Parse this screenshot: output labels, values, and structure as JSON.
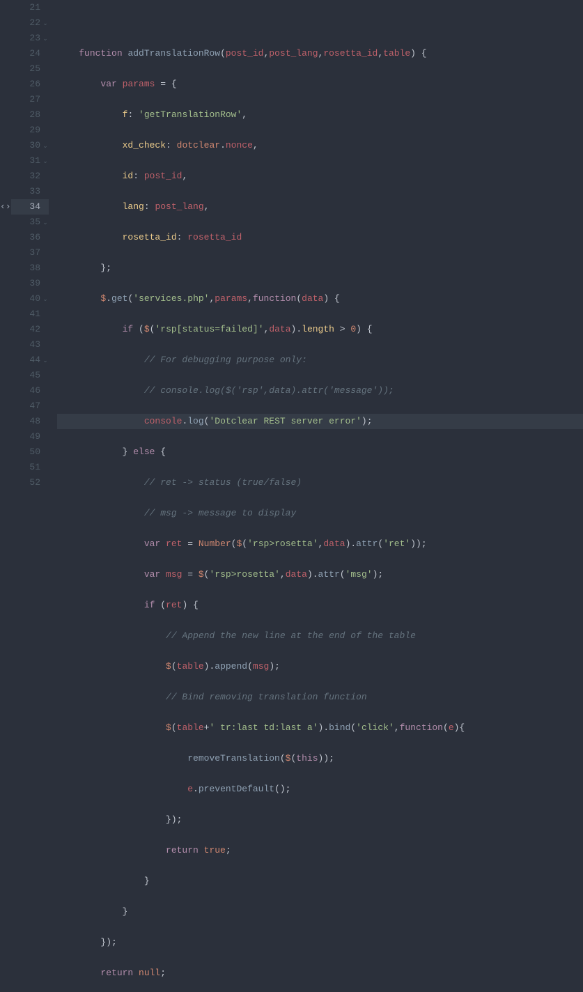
{
  "gutter": {
    "21": {
      "num": "21",
      "fold": ""
    },
    "22": {
      "num": "22",
      "fold": "⌄"
    },
    "23": {
      "num": "23",
      "fold": "⌄"
    },
    "24": {
      "num": "24",
      "fold": ""
    },
    "25": {
      "num": "25",
      "fold": ""
    },
    "26": {
      "num": "26",
      "fold": ""
    },
    "27": {
      "num": "27",
      "fold": ""
    },
    "28": {
      "num": "28",
      "fold": ""
    },
    "29": {
      "num": "29",
      "fold": ""
    },
    "30": {
      "num": "30",
      "fold": "⌄"
    },
    "31": {
      "num": "31",
      "fold": "⌄"
    },
    "32": {
      "num": "32",
      "fold": ""
    },
    "33": {
      "num": "33",
      "fold": ""
    },
    "34": {
      "num": "34",
      "fold": ""
    },
    "35": {
      "num": "35",
      "fold": "⌄"
    },
    "36": {
      "num": "36",
      "fold": ""
    },
    "37": {
      "num": "37",
      "fold": ""
    },
    "38": {
      "num": "38",
      "fold": ""
    },
    "39": {
      "num": "39",
      "fold": ""
    },
    "40": {
      "num": "40",
      "fold": "⌄"
    },
    "41": {
      "num": "41",
      "fold": ""
    },
    "42": {
      "num": "42",
      "fold": ""
    },
    "43": {
      "num": "43",
      "fold": ""
    },
    "44": {
      "num": "44",
      "fold": "⌄"
    },
    "45": {
      "num": "45",
      "fold": ""
    },
    "46": {
      "num": "46",
      "fold": ""
    },
    "47": {
      "num": "47",
      "fold": ""
    },
    "48": {
      "num": "48",
      "fold": ""
    },
    "49": {
      "num": "49",
      "fold": ""
    },
    "50": {
      "num": "50",
      "fold": ""
    },
    "51": {
      "num": "51",
      "fold": ""
    },
    "52": {
      "num": "52",
      "fold": ""
    }
  },
  "diffMark": "‹›",
  "code": {
    "l21": {
      "indent": ""
    },
    "l22": {
      "indent": "    ",
      "kw": "function ",
      "fn": "addTranslationRow",
      "open": "(",
      "p1": "post_id",
      "c": ",",
      "p2": "post_lang",
      "p3": "rosetta_id",
      "p4": "table",
      "close": ") {"
    },
    "l23": {
      "indent": "        ",
      "kw": "var ",
      "id": "params",
      "eq": " = {"
    },
    "l24": {
      "indent": "            ",
      "key": "f",
      "colon": ": ",
      "val": "'getTranslationRow'",
      "comma": ","
    },
    "l25": {
      "indent": "            ",
      "key": "xd_check",
      "colon": ": ",
      "obj": "dotclear",
      "dot": ".",
      "prop": "nonce",
      "comma": ","
    },
    "l26": {
      "indent": "            ",
      "key": "id",
      "colon": ": ",
      "val": "post_id",
      "comma": ","
    },
    "l27": {
      "indent": "            ",
      "key": "lang",
      "colon": ": ",
      "val": "post_lang",
      "comma": ","
    },
    "l28": {
      "indent": "            ",
      "key": "rosetta_id",
      "colon": ": ",
      "val": "rosetta_id"
    },
    "l29": {
      "indent": "        ",
      "close": "};"
    },
    "l30": {
      "indent": "        ",
      "d": "$",
      "dot": ".",
      "fn": "get",
      "open": "(",
      "s1": "'services.php'",
      "c": ",",
      "p1": "params",
      "kw": "function",
      "open2": "(",
      "p2": "data",
      "close2": ") {"
    },
    "l31": {
      "indent": "            ",
      "kw": "if ",
      "open": "(",
      "d": "$",
      "open2": "(",
      "s": "'rsp[status=failed]'",
      "c": ",",
      "p": "data",
      "close2": ").",
      "m": "length",
      "op": " > ",
      "n": "0",
      "close": ") {"
    },
    "l32": {
      "indent": "                ",
      "cmt": "// For debugging purpose only:"
    },
    "l33": {
      "indent": "                ",
      "cmt": "// console.log($('rsp',data).attr('message'));"
    },
    "l34": {
      "indent": "                ",
      "obj": "console",
      "dot": ".",
      "fn": "log",
      "open": "(",
      "s": "'Dotclear REST server error'",
      "close": ");"
    },
    "l35": {
      "indent": "            ",
      "close": "} ",
      "kw": "else ",
      "open": "{"
    },
    "l36": {
      "indent": "                ",
      "cmt": "// ret -> status (true/false)"
    },
    "l37": {
      "indent": "                ",
      "cmt": "// msg -> message to display"
    },
    "l38": {
      "indent": "                ",
      "kw": "var ",
      "id": "ret",
      "eq": " = ",
      "fn": "Number",
      "open": "(",
      "d": "$",
      "open2": "(",
      "s": "'rsp>rosetta'",
      "c": ",",
      "p": "data",
      "close2": ").",
      "m": "attr",
      "open3": "(",
      "s2": "'ret'",
      "close3": "));"
    },
    "l39": {
      "indent": "                ",
      "kw": "var ",
      "id": "msg",
      "eq": " = ",
      "d": "$",
      "open2": "(",
      "s": "'rsp>rosetta'",
      "c": ",",
      "p": "data",
      "close2": ").",
      "m": "attr",
      "open3": "(",
      "s2": "'msg'",
      "close3": ");"
    },
    "l40": {
      "indent": "                ",
      "kw": "if ",
      "open": "(",
      "id": "ret",
      "close": ") {"
    },
    "l41": {
      "indent": "                    ",
      "cmt": "// Append the new line at the end of the table"
    },
    "l42": {
      "indent": "                    ",
      "d": "$",
      "open": "(",
      "p": "table",
      "close": ").",
      "m": "append",
      "open2": "(",
      "p2": "msg",
      "close2": ");"
    },
    "l43": {
      "indent": "                    ",
      "cmt": "// Bind removing translation function"
    },
    "l44": {
      "indent": "                    ",
      "d": "$",
      "open": "(",
      "p": "table",
      "plus": "+",
      "s": "' tr:last td:last a'",
      "close": ").",
      "m": "bind",
      "open2": "(",
      "s2": "'click'",
      "c": ",",
      "kw": "function",
      "open3": "(",
      "p2": "e",
      "close3": "){"
    },
    "l45": {
      "indent": "                        ",
      "fn": "removeTranslation",
      "open": "(",
      "d": "$",
      "open2": "(",
      "kw": "this",
      "close2": "));"
    },
    "l46": {
      "indent": "                        ",
      "obj": "e",
      "dot": ".",
      "fn": "preventDefault",
      "open": "();"
    },
    "l47": {
      "indent": "                    ",
      "close": "});"
    },
    "l48": {
      "indent": "                    ",
      "kw": "return ",
      "val": "true",
      "semi": ";"
    },
    "l49": {
      "indent": "                ",
      "close": "}"
    },
    "l50": {
      "indent": "            ",
      "close": "}"
    },
    "l51": {
      "indent": "        ",
      "close": "});"
    },
    "l52": {
      "indent": "        ",
      "kw": "return ",
      "val": "null",
      "semi": ";"
    }
  }
}
